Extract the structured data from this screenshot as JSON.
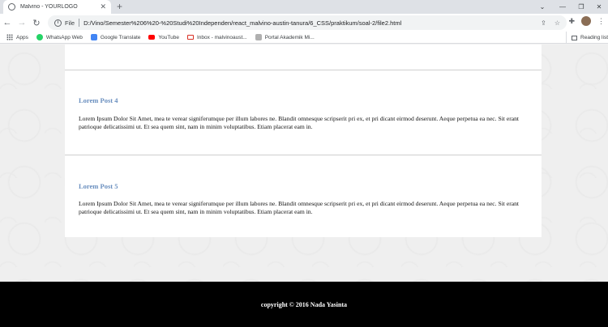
{
  "browser": {
    "tab_title": "Malvino - YOURLOGO",
    "new_tab": "+",
    "scheme": "File",
    "url": "D:/Vino/Semester%206%20-%20Studi%20Independen/react_malvino-austin-tanura/6_CSS/praktikum/soal-2/file2.html",
    "bookmarks": [
      {
        "label": "Apps",
        "icon": "apps-icon",
        "color": "#5f6368"
      },
      {
        "label": "WhatsApp Web",
        "icon": "whatsapp-icon",
        "color": "#25d366"
      },
      {
        "label": "Google Translate",
        "icon": "translate-icon",
        "color": "#4285f4"
      },
      {
        "label": "YouTube",
        "icon": "youtube-icon",
        "color": "#ff0000"
      },
      {
        "label": "Inbox - malvinoaust...",
        "icon": "gmail-icon",
        "color": "#d93025"
      },
      {
        "label": "Portal Akademik Mi...",
        "icon": "portal-icon",
        "color": "#8a8a8a"
      }
    ],
    "reading_list": "Reading list"
  },
  "posts": [
    {
      "title": "Lorem Post 4",
      "body": "Lorem Ipsum Dolor Sit Amet, mea te verear signiferumque per illum labores ne. Blandit omnesque scripserit pri ex, et pri dicant eirmod deserunt. Aeque perpetua ea nec. Sit erant patrioque delicatissimi ut. Et sea quem sint, nam in minim voluptatibus. Etiam placerat eam in."
    },
    {
      "title": "Lorem Post 5",
      "body": "Lorem Ipsum Dolor Sit Amet, mea te verear signiferumque per illum labores ne. Blandit omnesque scripserit pri ex, et pri dicant eirmod deserunt. Aeque perpetua ea nec. Sit erant patrioque delicatissimi ut. Et sea quem sint, nam in minim voluptatibus. Etiam placerat eam in."
    }
  ],
  "footer": {
    "text": "copyright © 2016 Nada Yasinta"
  },
  "colors": {
    "post_title": "#6a8fbf",
    "footer_bg": "#000000",
    "page_bg": "#efefef"
  }
}
